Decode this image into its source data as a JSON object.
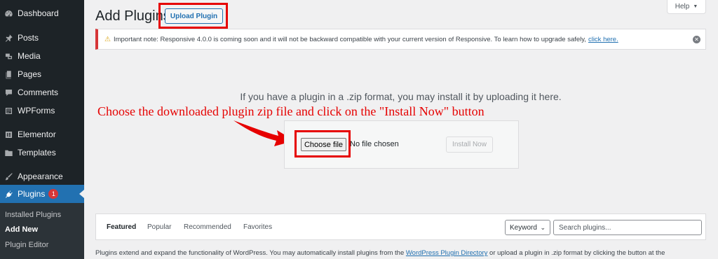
{
  "sidebar": {
    "items": [
      {
        "label": "Dashboard",
        "icon": "dashboard-icon"
      },
      {
        "label": "Posts",
        "icon": "pin-icon"
      },
      {
        "label": "Media",
        "icon": "media-icon"
      },
      {
        "label": "Pages",
        "icon": "pages-icon"
      },
      {
        "label": "Comments",
        "icon": "comment-icon"
      },
      {
        "label": "WPForms",
        "icon": "wpforms-icon"
      },
      {
        "label": "Elementor",
        "icon": "elementor-icon"
      },
      {
        "label": "Templates",
        "icon": "folder-icon"
      },
      {
        "label": "Appearance",
        "icon": "brush-icon"
      },
      {
        "label": "Plugins",
        "icon": "plugin-icon",
        "badge": "1"
      }
    ],
    "submenu": [
      "Installed Plugins",
      "Add New",
      "Plugin Editor"
    ]
  },
  "header": {
    "title": "Add Plugins",
    "upload_button": "Upload Plugin",
    "help": "Help"
  },
  "notice": {
    "text": "Important note: Responsive 4.0.0 is coming soon and it will not be backward compatible with your current version of Responsive. To learn how to upgrade safely,",
    "link": "click here."
  },
  "upload": {
    "description": "If you have a plugin in a .zip format, you may install it by uploading it here.",
    "annotation": "Choose the downloaded plugin zip file and click on the \"Install Now\" button",
    "choose_file": "Choose file",
    "file_status": "No file chosen",
    "install_button": "Install Now"
  },
  "filters": {
    "tabs": [
      "Featured",
      "Popular",
      "Recommended",
      "Favorites"
    ],
    "keyword": "Keyword",
    "search_placeholder": "Search plugins..."
  },
  "footer": {
    "text_before": "Plugins extend and expand the functionality of WordPress. You may automatically install plugins from the",
    "link": "WordPress Plugin Directory",
    "text_after": "or upload a plugin in .zip format by clicking the button at the"
  },
  "colors": {
    "sidebar_bg": "#1d2327",
    "active_blue": "#2271b1",
    "highlight_red": "#e60000",
    "notice_error": "#d63638"
  }
}
